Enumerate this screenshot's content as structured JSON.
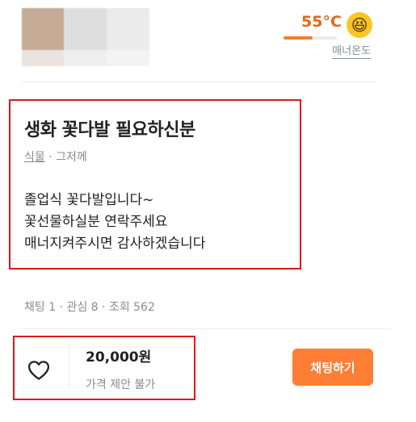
{
  "seller": {
    "manner_temp": "55°C",
    "manner_level": 0.55,
    "manner_face_icon": "laughing-face-icon",
    "manner_label": "매너온도"
  },
  "post": {
    "title": "생화 꽃다발 필요하신분",
    "category": "식물",
    "separator": " · ",
    "time": "그저께",
    "body_lines": [
      "졸업식 꽃다발입니다~",
      "꽃선물하실분 연락주세요",
      "매너지켜주시면 감사하겠습니다"
    ],
    "stats": "채팅 1 · 관심 8 · 조회 562"
  },
  "footer": {
    "heart_icon": "heart-outline-icon",
    "price": "20,000원",
    "negotiation": "가격 제안 불가",
    "chat_button": "채팅하기"
  },
  "colors": {
    "brand_orange": "#ff7e36",
    "temp_orange": "#e8651a",
    "highlight_red": "#e2151b",
    "muted_text": "#868b94"
  }
}
